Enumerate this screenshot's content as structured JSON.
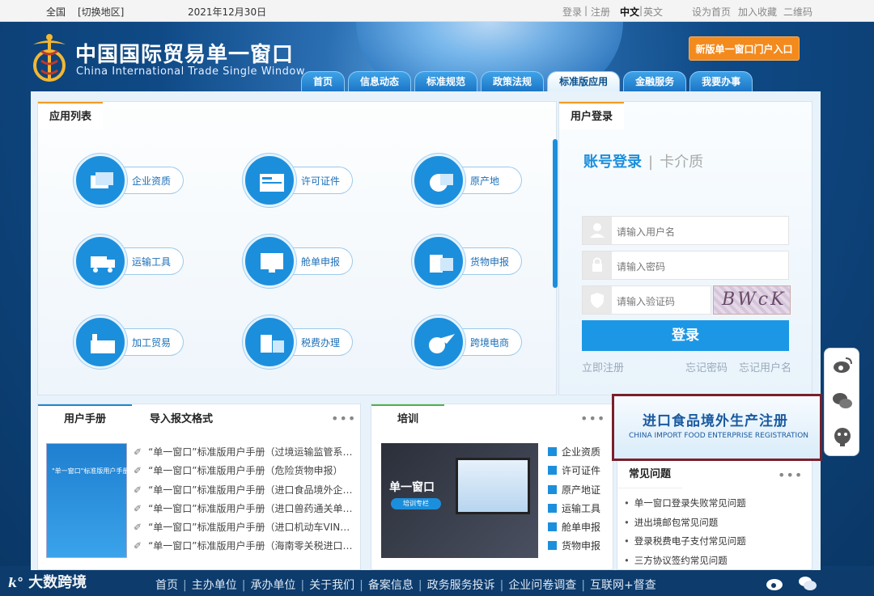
{
  "topbar": {
    "region": "全国",
    "switch_region": "[切换地区]",
    "date": "2021年12月30日",
    "login": "登录",
    "register": "注册",
    "lang_zh": "中文",
    "lang_en": "英文",
    "set_home": "设为首页",
    "bookmark": "加入收藏",
    "qrcode": "二维码"
  },
  "header": {
    "title": "中国国际贸易单一窗口",
    "subtitle": "China International Trade Single Window",
    "new_portal": "新版单一窗口门户入口"
  },
  "nav": [
    {
      "label": "首页",
      "active": false
    },
    {
      "label": "信息动态",
      "active": false
    },
    {
      "label": "标准规范",
      "active": false
    },
    {
      "label": "政策法规",
      "active": false
    },
    {
      "label": "标准版应用",
      "active": true
    },
    {
      "label": "金融服务",
      "active": false
    },
    {
      "label": "我要办事",
      "active": false
    }
  ],
  "apps": {
    "title": "应用列表",
    "items": [
      {
        "label": "企业资质",
        "icon": "card-icon"
      },
      {
        "label": "许可证件",
        "icon": "license-icon"
      },
      {
        "label": "原产地",
        "icon": "globe-icon"
      },
      {
        "label": "运输工具",
        "icon": "truck-icon"
      },
      {
        "label": "舱单申报",
        "icon": "monitor-icon"
      },
      {
        "label": "货物申报",
        "icon": "cargo-icon"
      },
      {
        "label": "加工贸易",
        "icon": "factory-icon"
      },
      {
        "label": "税费办理",
        "icon": "tax-icon"
      },
      {
        "label": "跨境电商",
        "icon": "plane-icon"
      }
    ]
  },
  "login": {
    "title": "用户登录",
    "tab_account": "账号登录",
    "tab_card": "卡介质",
    "username_placeholder": "请输入用户名",
    "password_placeholder": "请输入密码",
    "captcha_placeholder": "请输入验证码",
    "captcha_text": "BWcK",
    "submit": "登录",
    "register": "立即注册",
    "forgot_password": "忘记密码",
    "forgot_username": "忘记用户名"
  },
  "manual": {
    "tab_manual": "用户手册",
    "tab_format": "导入报文格式",
    "more": "•••",
    "book_title": "\"单一窗口\"标准版用户手册",
    "items": [
      "“单一窗口”标准版用户手册（过境运输监管系…",
      "“单一窗口”标准版用户手册（危险货物申报）",
      "“单一窗口”标准版用户手册（进口食品境外企…",
      "“单一窗口”标准版用户手册（进口兽药通关单…",
      "“单一窗口”标准版用户手册（进口机动车VIN…",
      "“单一窗口”标准版用户手册（海南零关税进口…"
    ]
  },
  "training": {
    "title": "培训",
    "more": "•••",
    "video_title": "单一窗口",
    "video_badge": "培训专栏",
    "items": [
      "企业资质",
      "许可证件",
      "原产地证",
      "运输工具",
      "舱单申报",
      "货物申报"
    ]
  },
  "banner": {
    "zh": "进口食品境外生产注册",
    "en": "CHINA IMPORT FOOD ENTERPRISE REGISTRATION"
  },
  "faq": {
    "title": "常见问题",
    "more": "•••",
    "items": [
      "单一窗口登录失败常见问题",
      "进出境邮包常见问题",
      "登录税费电子支付常见问题",
      "三方协议签约常见问题"
    ]
  },
  "footer": {
    "links": [
      "首页",
      "主办单位",
      "承办单位",
      "关于我们",
      "备案信息",
      "政务服务投诉",
      "企业问卷调查",
      "互联网+督查"
    ]
  },
  "watermark": "大数跨境",
  "colors": {
    "accent": "#1c8fdc",
    "orange": "#f38a1d",
    "banner_border": "#7b1f2b",
    "navy": "#0d3c6e"
  }
}
